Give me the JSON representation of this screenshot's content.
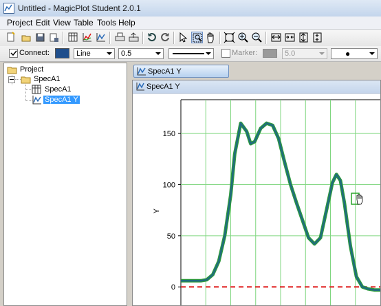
{
  "window": {
    "title": "Untitled - MagicPlot Student 2.0.1"
  },
  "menu": [
    "Project",
    "Edit",
    "View",
    "Table",
    "Tools",
    "Help"
  ],
  "toolbar_icons": [
    "new-project-icon",
    "open-icon",
    "save-icon",
    "save-as-icon",
    "new-table-icon",
    "new-plot-icon",
    "new-figure-icon",
    "print-icon",
    "export-icon",
    "undo-icon",
    "redo-icon",
    "select-pointer-icon",
    "zoom-select-icon",
    "pan-hand-icon",
    "fit-all-icon",
    "zoom-in-icon",
    "zoom-out-icon",
    "fit-horizontal-icon",
    "shrink-horizontal-icon",
    "fit-vertical-icon",
    "shrink-vertical-icon"
  ],
  "style_bar": {
    "connect_label": "Connect:",
    "connect_checked": true,
    "connect_color": "#1f4e8c",
    "line_type": "Line",
    "line_width": "0.5",
    "marker_label": "Marker:",
    "marker_checked": false,
    "marker_color": "#9a9a9a",
    "marker_size": "5.0",
    "marker_shape": "●"
  },
  "tree": {
    "project": "Project",
    "folder": "SpecA1",
    "table": "SpecA1",
    "plot": "SpecA1 Y"
  },
  "tab": {
    "label": "SpecA1 Y"
  },
  "document": {
    "title": "SpecA1 Y"
  },
  "colors": {
    "curve": "#1f6b80",
    "curve_outline": "#2e9a3c",
    "grid": "#7fd67f",
    "baseline": "#e02020"
  },
  "chart_data": {
    "type": "line",
    "ylabel": "Y",
    "xlabel": "",
    "yticks": [
      0,
      50,
      100,
      150
    ],
    "ylim": [
      -18,
      183
    ],
    "xlim": [
      0,
      100
    ],
    "series": [
      {
        "x": [
          0,
          5,
          10,
          13,
          16,
          19,
          22,
          25,
          27,
          30,
          33,
          35,
          37,
          40,
          43,
          46,
          49,
          52,
          55,
          58,
          61,
          64,
          67,
          70,
          73,
          76,
          78,
          80,
          82,
          85,
          88,
          91,
          94,
          97,
          100
        ],
        "values": [
          6,
          6,
          6,
          7,
          12,
          25,
          50,
          90,
          130,
          160,
          152,
          140,
          142,
          155,
          160,
          158,
          145,
          122,
          100,
          82,
          65,
          48,
          42,
          48,
          75,
          102,
          110,
          104,
          82,
          40,
          10,
          0,
          -2,
          -3,
          -3
        ]
      }
    ],
    "reference_line": {
      "y": 0,
      "style": "dashed"
    },
    "grid": true
  }
}
